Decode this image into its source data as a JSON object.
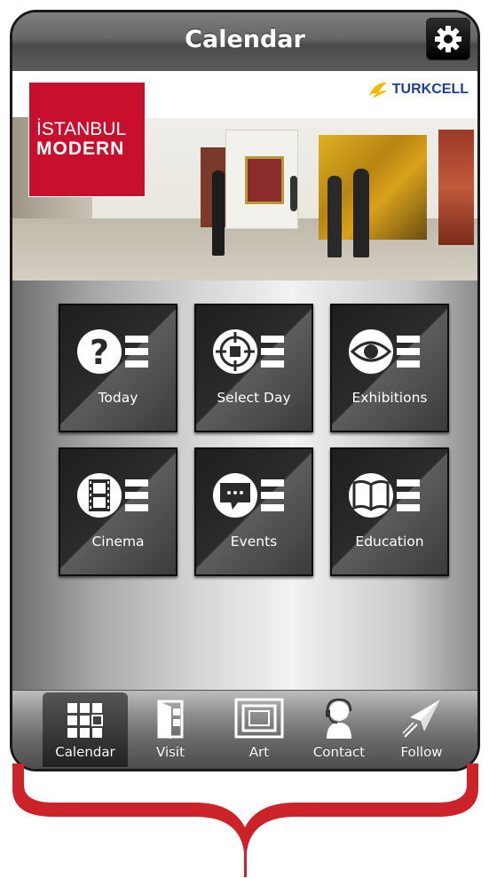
{
  "header": {
    "title": "Calendar",
    "settings_icon": "gear-icon"
  },
  "hero": {
    "logo_line1": "İSTANBUL",
    "logo_line2": "MODERN",
    "sponsor": "TURKCELL"
  },
  "tiles": [
    {
      "label": "Today",
      "icon": "question-mark-icon"
    },
    {
      "label": "Select Day",
      "icon": "crosshair-icon"
    },
    {
      "label": "Exhibitions",
      "icon": "eye-icon"
    },
    {
      "label": "Cinema",
      "icon": "film-icon"
    },
    {
      "label": "Events",
      "icon": "speech-bubble-icon"
    },
    {
      "label": "Education",
      "icon": "book-icon"
    }
  ],
  "tabbar": {
    "items": [
      {
        "label": "Calendar",
        "icon": "grid-icon",
        "active": true
      },
      {
        "label": "Visit",
        "icon": "door-icon",
        "active": false
      },
      {
        "label": "Art",
        "icon": "frame-icon",
        "active": false
      },
      {
        "label": "Contact",
        "icon": "headset-icon",
        "active": false
      },
      {
        "label": "Follow",
        "icon": "paper-plane-icon",
        "active": false
      }
    ]
  },
  "colors": {
    "brand_red": "#c8102e",
    "brace_red": "#cc2229",
    "sponsor_blue": "#1c3f94"
  }
}
